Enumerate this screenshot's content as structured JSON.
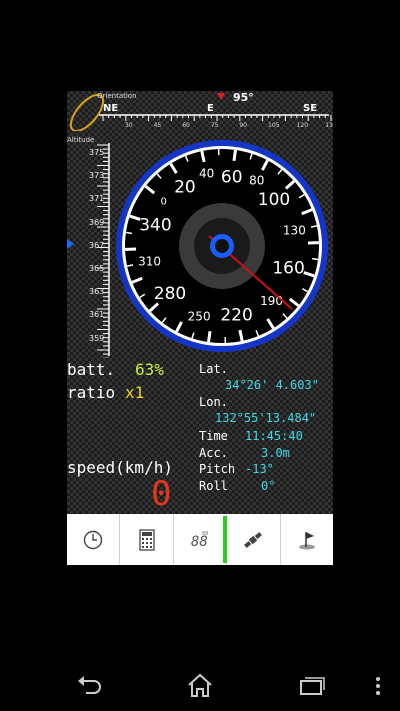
{
  "compass": {
    "orientation_label": "Orientation",
    "heading": "95°",
    "cardinals": [
      "NE",
      "E",
      "SE"
    ],
    "scale_labels": [
      "30",
      "45",
      "60",
      "75",
      "90",
      "105",
      "120",
      "135",
      "150"
    ]
  },
  "altitude": {
    "label": "Altitude",
    "ticks": [
      "375",
      "373",
      "371",
      "369",
      "367",
      "365",
      "363",
      "361",
      "359"
    ],
    "current": 367
  },
  "speedometer": {
    "labels": [
      "0",
      "20",
      "40",
      "60",
      "80",
      "100",
      "130",
      "160",
      "190",
      "220",
      "250",
      "280",
      "310",
      "340"
    ],
    "needle_value": 0,
    "colors": {
      "ring": "#1436c8",
      "needle": "#d01010",
      "hub": "#1a5cff"
    }
  },
  "status": {
    "batt_label": "batt.",
    "batt_value": "63%",
    "ratio_label": "ratio",
    "ratio_value": "x1",
    "speed_label": "speed(km/h)",
    "speed_value": "0"
  },
  "location": {
    "lat_label": "Lat.",
    "lat_value": "34°26' 4.603\"",
    "lon_label": "Lon.",
    "lon_value": "132°55'13.484\"",
    "time_label": "Time",
    "time_value": "11:45:40",
    "acc_label": "Acc.",
    "acc_value": "3.0m",
    "pitch_label": "Pitch",
    "pitch_value": "-13°",
    "roll_label": "Roll",
    "roll_value": "0°"
  },
  "toolbar": {
    "items": [
      "clock-icon",
      "calculator-icon",
      "digits-icon",
      "satellite-icon",
      "flag-icon"
    ],
    "active_color": "#2ecc1e"
  },
  "navbar": {
    "items": [
      "back-icon",
      "home-icon",
      "recents-icon",
      "menu-icon"
    ]
  }
}
